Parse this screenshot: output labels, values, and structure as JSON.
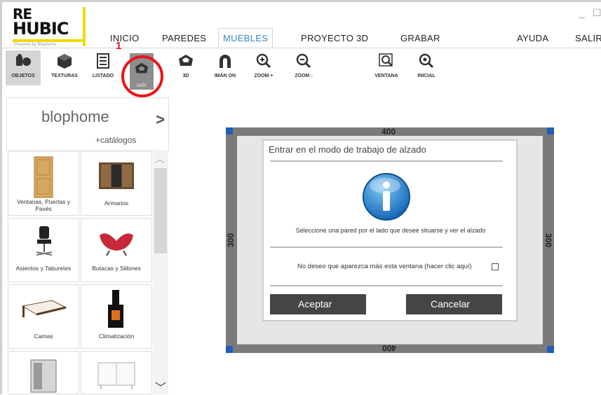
{
  "logo": {
    "line1": "RE",
    "line2": "HUBIC",
    "tagline": "Powered by Blophome"
  },
  "nav": {
    "items": [
      "INICIO",
      "PAREDES",
      "MUEBLES",
      "PROYECTO 3D",
      "GRABAR",
      "AYUDA",
      "SALIR"
    ],
    "active": "MUEBLES"
  },
  "window": {
    "minimize": "_",
    "maximize": "☐"
  },
  "annotation": {
    "marker": "1"
  },
  "toolbar": {
    "objetos": "OBJETOS",
    "texturas": "TEXTURAS",
    "listado": "LISTADO",
    "salir": "salir",
    "vista3d": "3D",
    "iman": "IMÁN ON",
    "zoom_in": "ZOOM +",
    "zoom_out": "ZOOM -",
    "ventana": "VENTANA",
    "inicial": "INICIAL"
  },
  "sidebar": {
    "brand": "blophome",
    "catalogs": "+catálogos",
    "next_arrow": ">",
    "categories": [
      {
        "label": "Ventanas, Puertas y Pavés"
      },
      {
        "label": "Armarios"
      },
      {
        "label": "Asientos y Taburetes"
      },
      {
        "label": "Butacas y Sillones"
      },
      {
        "label": "Camas"
      },
      {
        "label": "Climatización"
      },
      {
        "label": ""
      },
      {
        "label": ""
      }
    ]
  },
  "room": {
    "top": "400",
    "bottom": "400",
    "left": "300",
    "right": "300"
  },
  "dialog": {
    "title": "Entrar en el modo de trabajo de alzado",
    "message": "Seleccione una pared por el lado que desee situarse y ver el alzado",
    "checkbox_label": "No deseo que aparezca más esta ventana (hacer clic aquí)",
    "accept": "Aceptar",
    "cancel": "Cancelar"
  },
  "colors": {
    "accent": "#3b88c4",
    "highlight": "#e8161a",
    "logo_yellow": "#f2d800",
    "corner_blue": "#1f5fb5"
  }
}
